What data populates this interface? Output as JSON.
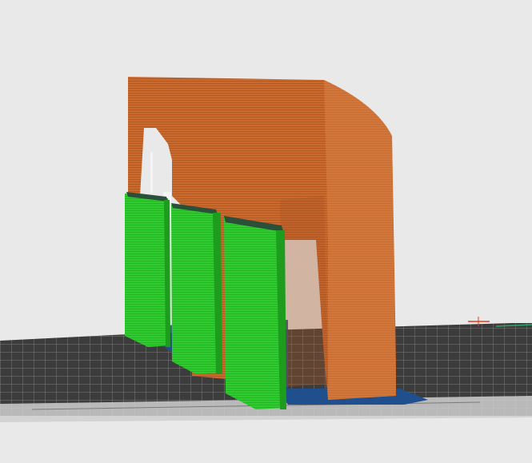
{
  "viewer": {
    "mode": "preview",
    "background_color": "#e9e9e9"
  },
  "colors": {
    "bed_surface": "#3c3c3c",
    "bed_grid_line": "#8c8c8c",
    "bed_grid_minor": "#5a5a5a",
    "bed_highlight": "#f2f2f2",
    "support_green": "#2ecc2e",
    "support_green_dark": "#1d9c1d",
    "support_top": "#2c4f3a",
    "shell_orange": "#cc6a2e",
    "shell_orange_dark": "#a85422",
    "shell_orange_light": "#d98046",
    "first_layer_blue": "#1f4f8c",
    "origin_marker_red": "#e23a1a",
    "origin_marker_green": "#2fa86a"
  },
  "icons": {
    "origin_axes": "origin-axes-icon"
  }
}
